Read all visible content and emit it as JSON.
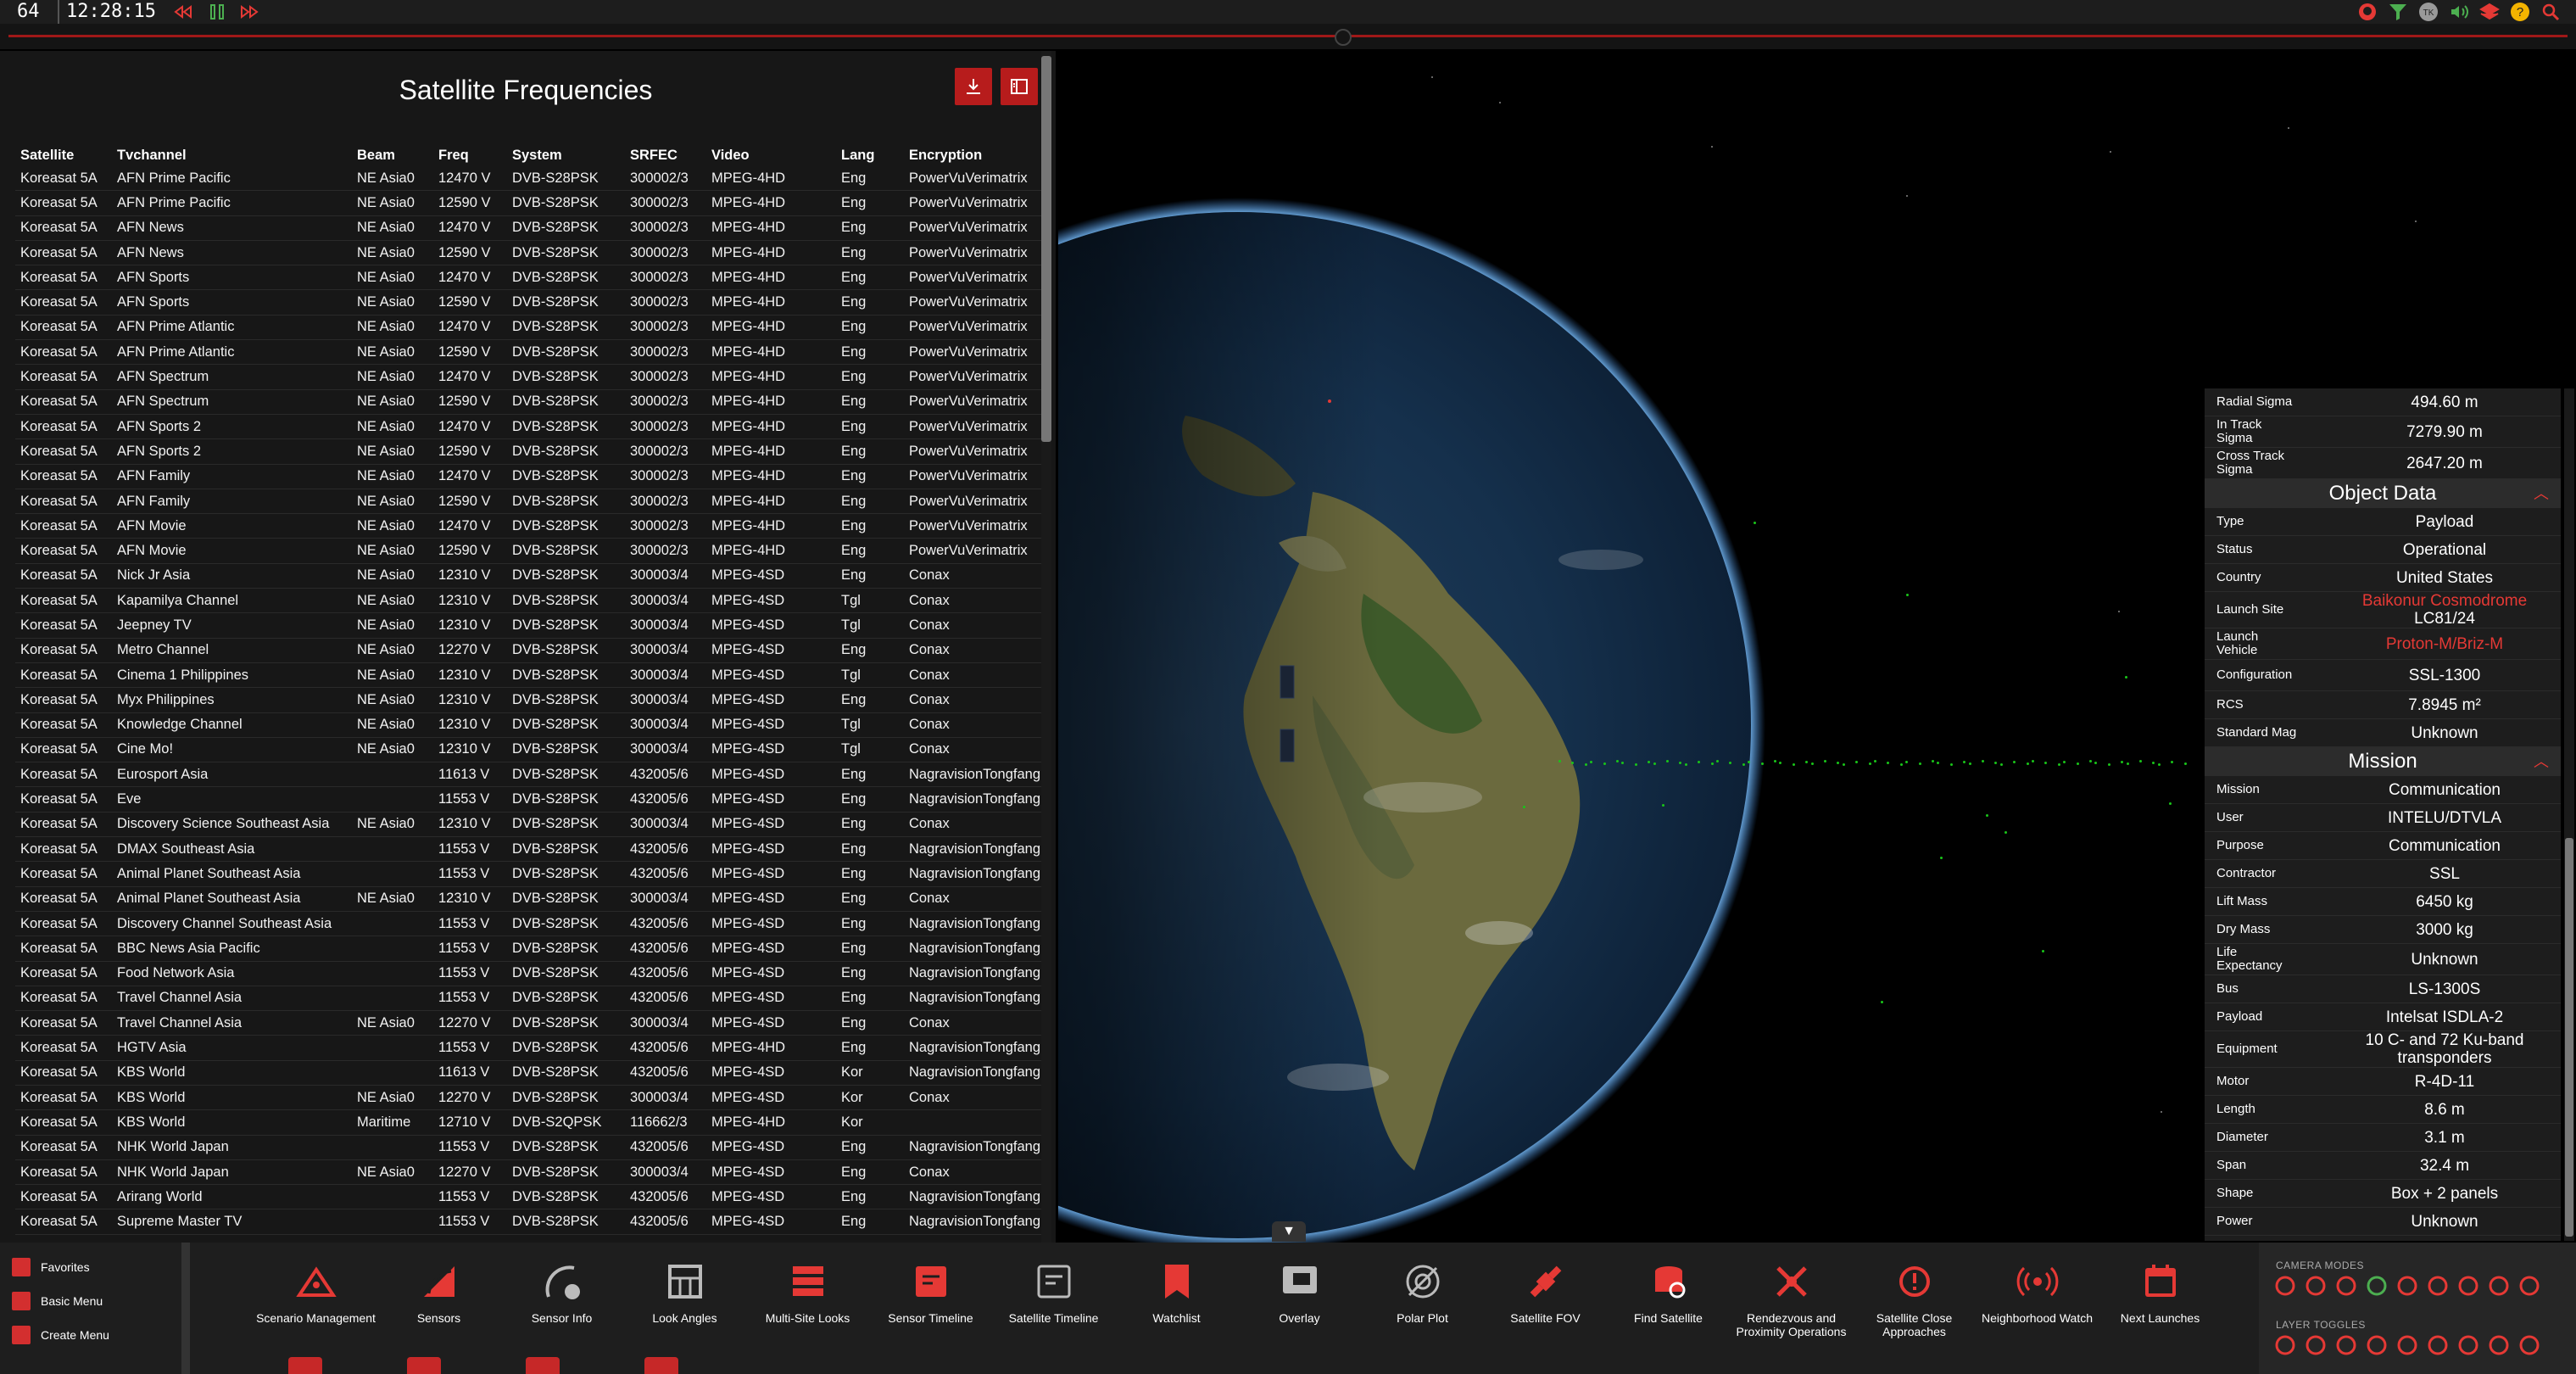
{
  "topbar": {
    "fps": "64",
    "clock": "12:28:15",
    "time_controls": [
      "rewind-icon",
      "pause-icon",
      "fast-forward-icon"
    ],
    "right_icons": [
      "github-icon",
      "filter-icon",
      "user-avatar-icon",
      "volume-icon",
      "layers-icon",
      "help-icon",
      "search-icon"
    ]
  },
  "panel": {
    "title": "Satellite Frequencies",
    "download_icon": "download-icon",
    "collapse_icon": "panel-toggle-icon"
  },
  "table": {
    "headers": [
      "Satellite",
      "Tvchannel",
      "Beam",
      "Freq",
      "System",
      "SRFEC",
      "Video",
      "Lang",
      "Encryption"
    ],
    "rows": [
      [
        "Koreasat 5A",
        "AFN Prime Pacific",
        "NE Asia0",
        "12470 V",
        "DVB-S28PSK",
        "300002/3",
        "MPEG-4HD",
        "Eng",
        "PowerVuVerimatrix"
      ],
      [
        "Koreasat 5A",
        "AFN Prime Pacific",
        "NE Asia0",
        "12590 V",
        "DVB-S28PSK",
        "300002/3",
        "MPEG-4HD",
        "Eng",
        "PowerVuVerimatrix"
      ],
      [
        "Koreasat 5A",
        "AFN News",
        "NE Asia0",
        "12470 V",
        "DVB-S28PSK",
        "300002/3",
        "MPEG-4HD",
        "Eng",
        "PowerVuVerimatrix"
      ],
      [
        "Koreasat 5A",
        "AFN News",
        "NE Asia0",
        "12590 V",
        "DVB-S28PSK",
        "300002/3",
        "MPEG-4HD",
        "Eng",
        "PowerVuVerimatrix"
      ],
      [
        "Koreasat 5A",
        "AFN Sports",
        "NE Asia0",
        "12470 V",
        "DVB-S28PSK",
        "300002/3",
        "MPEG-4HD",
        "Eng",
        "PowerVuVerimatrix"
      ],
      [
        "Koreasat 5A",
        "AFN Sports",
        "NE Asia0",
        "12590 V",
        "DVB-S28PSK",
        "300002/3",
        "MPEG-4HD",
        "Eng",
        "PowerVuVerimatrix"
      ],
      [
        "Koreasat 5A",
        "AFN Prime Atlantic",
        "NE Asia0",
        "12470 V",
        "DVB-S28PSK",
        "300002/3",
        "MPEG-4HD",
        "Eng",
        "PowerVuVerimatrix"
      ],
      [
        "Koreasat 5A",
        "AFN Prime Atlantic",
        "NE Asia0",
        "12590 V",
        "DVB-S28PSK",
        "300002/3",
        "MPEG-4HD",
        "Eng",
        "PowerVuVerimatrix"
      ],
      [
        "Koreasat 5A",
        "AFN Spectrum",
        "NE Asia0",
        "12470 V",
        "DVB-S28PSK",
        "300002/3",
        "MPEG-4HD",
        "Eng",
        "PowerVuVerimatrix"
      ],
      [
        "Koreasat 5A",
        "AFN Spectrum",
        "NE Asia0",
        "12590 V",
        "DVB-S28PSK",
        "300002/3",
        "MPEG-4HD",
        "Eng",
        "PowerVuVerimatrix"
      ],
      [
        "Koreasat 5A",
        "AFN Sports 2",
        "NE Asia0",
        "12470 V",
        "DVB-S28PSK",
        "300002/3",
        "MPEG-4HD",
        "Eng",
        "PowerVuVerimatrix"
      ],
      [
        "Koreasat 5A",
        "AFN Sports 2",
        "NE Asia0",
        "12590 V",
        "DVB-S28PSK",
        "300002/3",
        "MPEG-4HD",
        "Eng",
        "PowerVuVerimatrix"
      ],
      [
        "Koreasat 5A",
        "AFN Family",
        "NE Asia0",
        "12470 V",
        "DVB-S28PSK",
        "300002/3",
        "MPEG-4HD",
        "Eng",
        "PowerVuVerimatrix"
      ],
      [
        "Koreasat 5A",
        "AFN Family",
        "NE Asia0",
        "12590 V",
        "DVB-S28PSK",
        "300002/3",
        "MPEG-4HD",
        "Eng",
        "PowerVuVerimatrix"
      ],
      [
        "Koreasat 5A",
        "AFN Movie",
        "NE Asia0",
        "12470 V",
        "DVB-S28PSK",
        "300002/3",
        "MPEG-4HD",
        "Eng",
        "PowerVuVerimatrix"
      ],
      [
        "Koreasat 5A",
        "AFN Movie",
        "NE Asia0",
        "12590 V",
        "DVB-S28PSK",
        "300002/3",
        "MPEG-4HD",
        "Eng",
        "PowerVuVerimatrix"
      ],
      [
        "Koreasat 5A",
        "Nick Jr Asia",
        "NE Asia0",
        "12310 V",
        "DVB-S28PSK",
        "300003/4",
        "MPEG-4SD",
        "Eng",
        "Conax"
      ],
      [
        "Koreasat 5A",
        "Kapamilya Channel",
        "NE Asia0",
        "12310 V",
        "DVB-S28PSK",
        "300003/4",
        "MPEG-4SD",
        "Tgl",
        "Conax"
      ],
      [
        "Koreasat 5A",
        "Jeepney TV",
        "NE Asia0",
        "12310 V",
        "DVB-S28PSK",
        "300003/4",
        "MPEG-4SD",
        "Tgl",
        "Conax"
      ],
      [
        "Koreasat 5A",
        "Metro Channel",
        "NE Asia0",
        "12270 V",
        "DVB-S28PSK",
        "300003/4",
        "MPEG-4SD",
        "Eng",
        "Conax"
      ],
      [
        "Koreasat 5A",
        "Cinema 1 Philippines",
        "NE Asia0",
        "12310 V",
        "DVB-S28PSK",
        "300003/4",
        "MPEG-4SD",
        "Tgl",
        "Conax"
      ],
      [
        "Koreasat 5A",
        "Myx Philippines",
        "NE Asia0",
        "12310 V",
        "DVB-S28PSK",
        "300003/4",
        "MPEG-4SD",
        "Eng",
        "Conax"
      ],
      [
        "Koreasat 5A",
        "Knowledge Channel",
        "NE Asia0",
        "12310 V",
        "DVB-S28PSK",
        "300003/4",
        "MPEG-4SD",
        "Tgl",
        "Conax"
      ],
      [
        "Koreasat 5A",
        "Cine Mo!",
        "NE Asia0",
        "12310 V",
        "DVB-S28PSK",
        "300003/4",
        "MPEG-4SD",
        "Tgl",
        "Conax"
      ],
      [
        "Koreasat 5A",
        "Eurosport Asia",
        "",
        "11613 V",
        "DVB-S28PSK",
        "432005/6",
        "MPEG-4SD",
        "Eng",
        "NagravisionTongfang"
      ],
      [
        "Koreasat 5A",
        "Eve",
        "",
        "11553 V",
        "DVB-S28PSK",
        "432005/6",
        "MPEG-4SD",
        "Eng",
        "NagravisionTongfang"
      ],
      [
        "Koreasat 5A",
        "Discovery Science Southeast Asia",
        "NE Asia0",
        "12310 V",
        "DVB-S28PSK",
        "300003/4",
        "MPEG-4SD",
        "Eng",
        "Conax"
      ],
      [
        "Koreasat 5A",
        "DMAX Southeast Asia",
        "",
        "11553 V",
        "DVB-S28PSK",
        "432005/6",
        "MPEG-4SD",
        "Eng",
        "NagravisionTongfang"
      ],
      [
        "Koreasat 5A",
        "Animal Planet Southeast Asia",
        "",
        "11553 V",
        "DVB-S28PSK",
        "432005/6",
        "MPEG-4SD",
        "Eng",
        "NagravisionTongfang"
      ],
      [
        "Koreasat 5A",
        "Animal Planet Southeast Asia",
        "NE Asia0",
        "12310 V",
        "DVB-S28PSK",
        "300003/4",
        "MPEG-4SD",
        "Eng",
        "Conax"
      ],
      [
        "Koreasat 5A",
        "Discovery Channel Southeast Asia",
        "",
        "11553 V",
        "DVB-S28PSK",
        "432005/6",
        "MPEG-4SD",
        "Eng",
        "NagravisionTongfang"
      ],
      [
        "Koreasat 5A",
        "BBC News Asia Pacific",
        "",
        "11553 V",
        "DVB-S28PSK",
        "432005/6",
        "MPEG-4SD",
        "Eng",
        "NagravisionTongfang"
      ],
      [
        "Koreasat 5A",
        "Food Network Asia",
        "",
        "11553 V",
        "DVB-S28PSK",
        "432005/6",
        "MPEG-4SD",
        "Eng",
        "NagravisionTongfang"
      ],
      [
        "Koreasat 5A",
        "Travel Channel Asia",
        "",
        "11553 V",
        "DVB-S28PSK",
        "432005/6",
        "MPEG-4SD",
        "Eng",
        "NagravisionTongfang"
      ],
      [
        "Koreasat 5A",
        "Travel Channel Asia",
        "NE Asia0",
        "12270 V",
        "DVB-S28PSK",
        "300003/4",
        "MPEG-4SD",
        "Eng",
        "Conax"
      ],
      [
        "Koreasat 5A",
        "HGTV Asia",
        "",
        "11553 V",
        "DVB-S28PSK",
        "432005/6",
        "MPEG-4HD",
        "Eng",
        "NagravisionTongfang"
      ],
      [
        "Koreasat 5A",
        "KBS World",
        "",
        "11613 V",
        "DVB-S28PSK",
        "432005/6",
        "MPEG-4SD",
        "Kor",
        "NagravisionTongfang"
      ],
      [
        "Koreasat 5A",
        "KBS World",
        "NE Asia0",
        "12270 V",
        "DVB-S28PSK",
        "300003/4",
        "MPEG-4SD",
        "Kor",
        "Conax"
      ],
      [
        "Koreasat 5A",
        "KBS World",
        "Maritime",
        "12710 V",
        "DVB-S2QPSK",
        "116662/3",
        "MPEG-4HD",
        "Kor",
        ""
      ],
      [
        "Koreasat 5A",
        "NHK World Japan",
        "",
        "11553 V",
        "DVB-S28PSK",
        "432005/6",
        "MPEG-4SD",
        "Eng",
        "NagravisionTongfang"
      ],
      [
        "Koreasat 5A",
        "NHK World Japan",
        "NE Asia0",
        "12270 V",
        "DVB-S28PSK",
        "300003/4",
        "MPEG-4SD",
        "Eng",
        "Conax"
      ],
      [
        "Koreasat 5A",
        "Arirang World",
        "",
        "11553 V",
        "DVB-S28PSK",
        "432005/6",
        "MPEG-4SD",
        "Eng",
        "NagravisionTongfang"
      ],
      [
        "Koreasat 5A",
        "Supreme Master TV",
        "",
        "11553 V",
        "DVB-S28PSK",
        "432005/6",
        "MPEG-4SD",
        "Eng",
        "NagravisionTongfang"
      ]
    ]
  },
  "info": {
    "uncertainty": [
      {
        "label": "Radial Sigma",
        "value": "494.60 m"
      },
      {
        "label": "In Track Sigma",
        "value": "7279.90 m"
      },
      {
        "label": "Cross Track Sigma",
        "value": "2647.20 m"
      }
    ],
    "object_data_title": "Object Data",
    "object_data": [
      {
        "label": "Type",
        "value": "Payload"
      },
      {
        "label": "Status",
        "value": "Operational"
      },
      {
        "label": "Country",
        "value": "United States"
      },
      {
        "label": "Launch Site",
        "value": "Baikonur Cosmodrome",
        "value2": "LC81/24",
        "link": true
      },
      {
        "label": "Launch Vehicle",
        "value": "Proton-M/Briz-M",
        "link": true
      },
      {
        "label": "Configuration",
        "value": "SSL-1300"
      },
      {
        "label": "RCS",
        "value": "7.8945 m²"
      },
      {
        "label": "Standard Mag",
        "value": "Unknown"
      }
    ],
    "mission_title": "Mission",
    "mission": [
      {
        "label": "Mission",
        "value": "Communication"
      },
      {
        "label": "User",
        "value": "INTELU/DTVLA"
      },
      {
        "label": "Purpose",
        "value": "Communication"
      },
      {
        "label": "Contractor",
        "value": "SSL"
      },
      {
        "label": "Lift Mass",
        "value": "6450 kg"
      },
      {
        "label": "Dry Mass",
        "value": "3000 kg"
      },
      {
        "label": "Life Expectancy",
        "value": "Unknown"
      },
      {
        "label": "Bus",
        "value": "LS-1300S"
      },
      {
        "label": "Payload",
        "value": "Intelsat ISDLA-2"
      },
      {
        "label": "Equipment",
        "value": "10 C- and 72 Ku-band transponders"
      },
      {
        "label": "Motor",
        "value": "R-4D-11"
      },
      {
        "label": "Length",
        "value": "8.6 m"
      },
      {
        "label": "Diameter",
        "value": "3.1 m"
      },
      {
        "label": "Span",
        "value": "32.4 m"
      },
      {
        "label": "Shape",
        "value": "Box + 2 panels"
      },
      {
        "label": "Power",
        "value": "Unknown"
      }
    ]
  },
  "menus": [
    {
      "label": "Favorites",
      "icon": "bookmark-icon"
    },
    {
      "label": "Basic Menu",
      "icon": "menu-icon"
    },
    {
      "label": "Create Menu",
      "icon": "create-icon"
    }
  ],
  "tools": [
    {
      "label": "Scenario Management",
      "icon": "scenario-icon"
    },
    {
      "label": "Sensors",
      "icon": "sensor-icon"
    },
    {
      "label": "Sensor Info",
      "icon": "sensor-info-icon"
    },
    {
      "label": "Look Angles",
      "icon": "look-angles-icon"
    },
    {
      "label": "Multi-Site Looks",
      "icon": "multi-site-icon"
    },
    {
      "label": "Sensor Timeline",
      "icon": "sensor-timeline-icon"
    },
    {
      "label": "Satellite Timeline",
      "icon": "satellite-timeline-icon"
    },
    {
      "label": "Watchlist",
      "icon": "watchlist-icon"
    },
    {
      "label": "Overlay",
      "icon": "overlay-icon"
    },
    {
      "label": "Polar Plot",
      "icon": "polar-plot-icon"
    },
    {
      "label": "Satellite FOV",
      "icon": "satellite-fov-icon"
    },
    {
      "label": "Find Satellite",
      "icon": "find-satellite-icon"
    },
    {
      "label": "Rendezvous and Proximity Operations",
      "icon": "rendezvous-icon"
    },
    {
      "label": "Satellite Close Approaches",
      "icon": "close-approach-icon"
    },
    {
      "label": "Neighborhood Watch",
      "icon": "neighborhood-watch-icon"
    },
    {
      "label": "Next Launches",
      "icon": "calendar-icon"
    }
  ],
  "camera_modes_title": "CAMERA MODES",
  "layer_toggles_title": "LAYER TOGGLES",
  "colors": {
    "accent": "#b71c1c",
    "link": "#e53935",
    "panel": "#171717",
    "satellite": "#19c419"
  }
}
